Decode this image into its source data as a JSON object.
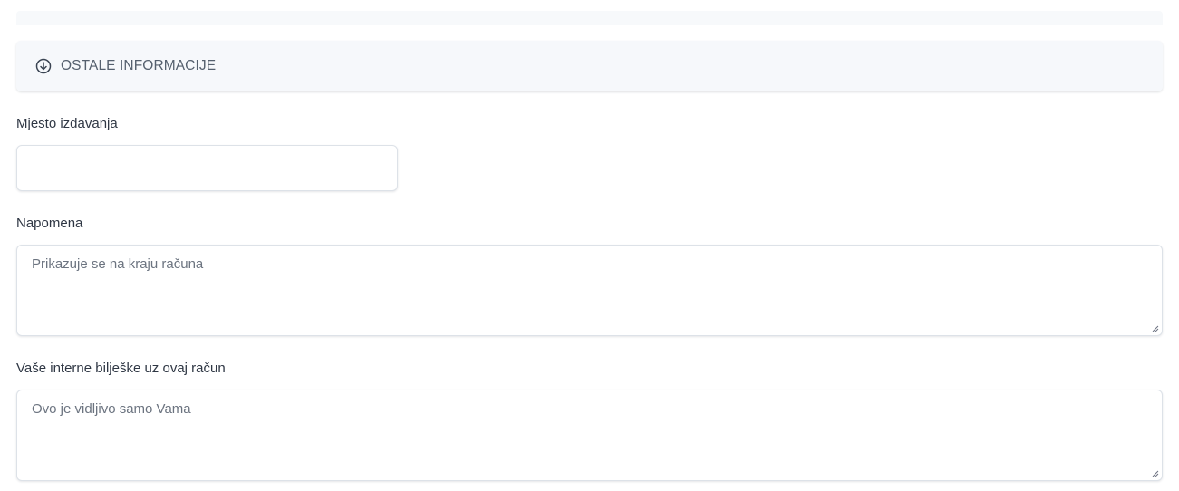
{
  "section": {
    "title": "OSTALE INFORMACIJE",
    "icon": "arrow-circle-down-icon"
  },
  "fields": {
    "place_of_issue": {
      "label": "Mjesto izdavanja",
      "value": "",
      "placeholder": ""
    },
    "note": {
      "label": "Napomena",
      "value": "",
      "placeholder": "Prikazuje se na kraju računa"
    },
    "internal_notes": {
      "label": "Vaše interne bilješke uz ovaj račun",
      "value": "",
      "placeholder": "Ovo je vidljivo samo Vama"
    }
  },
  "colors": {
    "header_bg": "#f6f8fb",
    "border": "#dde2e8",
    "text": "#2f3744",
    "muted_text": "#55606e"
  }
}
